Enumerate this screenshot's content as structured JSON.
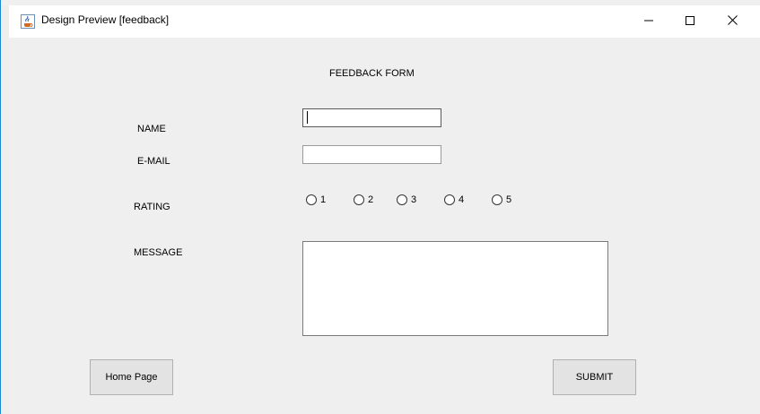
{
  "window": {
    "title": "Design Preview [feedback]",
    "controls": {
      "minimize": "–",
      "maximize": "☐",
      "close": "✕"
    }
  },
  "form": {
    "heading": "FEEDBACK FORM",
    "fields": {
      "name": {
        "label": "NAME",
        "value": ""
      },
      "email": {
        "label": "E-MAIL",
        "value": ""
      },
      "message": {
        "label": "MESSAGE",
        "value": ""
      }
    },
    "rating": {
      "label": "RATING",
      "options": [
        "1",
        "2",
        "3",
        "4",
        "5"
      ],
      "selected": null
    },
    "buttons": {
      "home": "Home Page",
      "submit": "SUBMIT"
    }
  },
  "icons": {
    "app": "java-coffee-cup-icon",
    "minimize": "minimize-icon",
    "maximize": "maximize-icon",
    "close": "close-icon"
  },
  "colors": {
    "window_border": "#1a8ad4",
    "background": "#efefef"
  }
}
